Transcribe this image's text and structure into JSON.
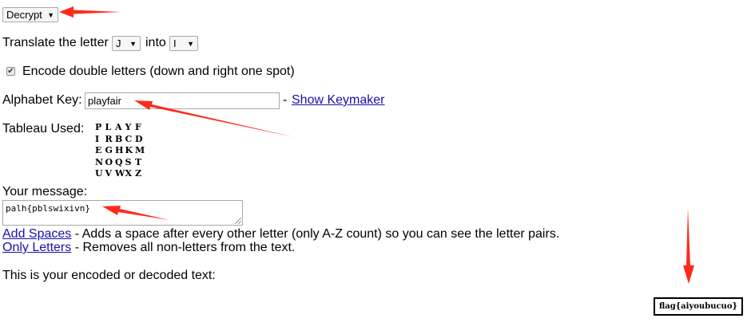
{
  "mode_select": {
    "value": "Decrypt"
  },
  "translate": {
    "label": "Translate the letter",
    "from_value": "J",
    "into_label": "into",
    "to_value": "I"
  },
  "double_letters": {
    "checked": true,
    "label": "Encode double letters (down and right one spot)"
  },
  "alphabet_key": {
    "label": "Alphabet Key:",
    "value": "playfair",
    "separator": "-",
    "keymaker_link": "Show Keymaker"
  },
  "tableau": {
    "label": "Tableau Used:",
    "rows": [
      [
        "P",
        "L",
        "A",
        "Y",
        "F"
      ],
      [
        "I",
        "R",
        "B",
        "C",
        "D"
      ],
      [
        "E",
        "G",
        "H",
        "K",
        "M"
      ],
      [
        "N",
        "O",
        "Q",
        "S",
        "T"
      ],
      [
        "U",
        "V",
        "W",
        "X",
        "Z"
      ]
    ]
  },
  "message": {
    "label": "Your message:",
    "value": "palh{pblswixivn}"
  },
  "add_spaces": {
    "link": "Add Spaces",
    "description": "- Adds a space after every other letter (only A-Z count) so you can see the letter pairs."
  },
  "only_letters": {
    "link": "Only Letters",
    "description": "- Removes all non-letters from the text."
  },
  "output": {
    "label": "This is your encoded or decoded text:",
    "value": "flag{aiyoubucuo}"
  },
  "colors": {
    "arrow": "#ff2a1a",
    "link": "#1a0dab"
  },
  "icons": [
    "select-caret-icon",
    "checkbox-check-icon",
    "textarea-resize-grip-icon",
    "annotation-arrow-icon"
  ]
}
